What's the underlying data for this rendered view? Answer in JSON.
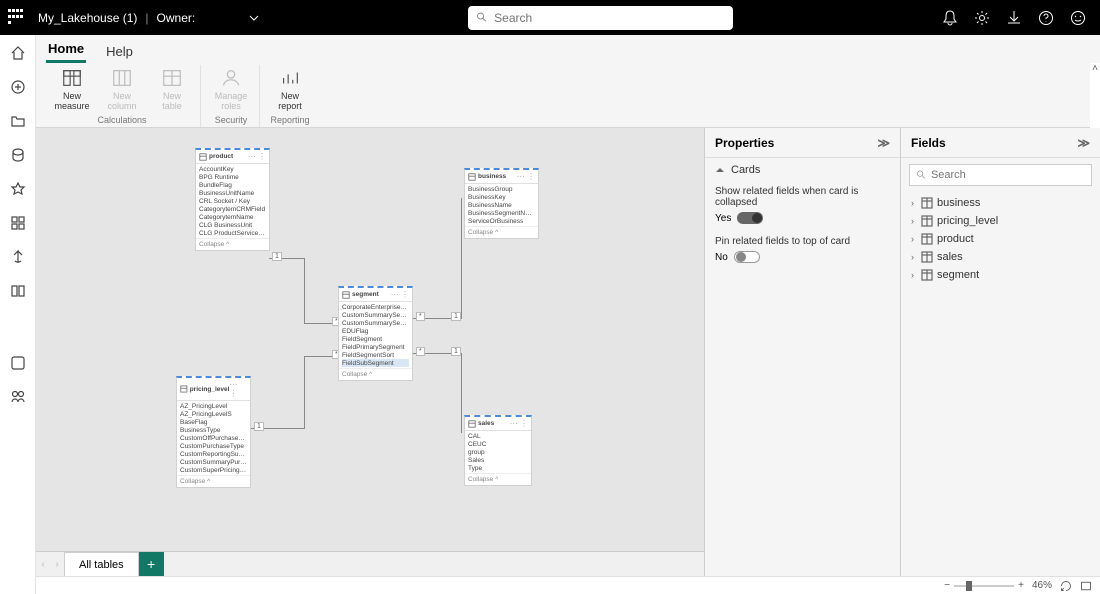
{
  "topbar": {
    "title": "My_Lakehouse (1)",
    "owner_label": "Owner:",
    "search_placeholder": "Search"
  },
  "ribbon": {
    "tabs": [
      "Home",
      "Help"
    ],
    "active_tab": 0,
    "groups": [
      {
        "label": "Calculations",
        "buttons": [
          {
            "l1": "New",
            "l2": "measure",
            "enabled": true
          },
          {
            "l1": "New",
            "l2": "column",
            "enabled": false
          },
          {
            "l1": "New",
            "l2": "table",
            "enabled": false
          }
        ]
      },
      {
        "label": "Security",
        "buttons": [
          {
            "l1": "Manage",
            "l2": "roles",
            "enabled": false
          }
        ]
      },
      {
        "label": "Reporting",
        "buttons": [
          {
            "l1": "New",
            "l2": "report",
            "enabled": true
          }
        ]
      }
    ]
  },
  "tables": {
    "product": {
      "name": "product",
      "collapse": "Collapse ^",
      "fields": [
        "AccountKey",
        "BPG Runtime",
        "BundleFlag",
        "BusinessUnitName",
        "CRL Socket / Key",
        "CategorytemCRMField",
        "CategorytemName",
        "CLG BusinessUnit",
        "CLG ProductServiceBundleDevice"
      ]
    },
    "business": {
      "name": "business",
      "collapse": "Collapse ^",
      "fields": [
        "BusinessGroup",
        "BusinessKey",
        "BusinessName",
        "BusinessSegmentName",
        "ServiceOrBusiness"
      ]
    },
    "segment": {
      "name": "segment",
      "collapse": "Collapse ^",
      "fields": [
        "CorporateEnterpriseFlag",
        "CustomSummarySector",
        "CustomSummarySegment",
        "EDUFlag",
        "FieldSegment",
        "FieldPrimarySegment",
        "FieldSegmentSort",
        "FieldSubSegment"
      ]
    },
    "pricing_level": {
      "name": "pricing_level",
      "collapse": "Collapse ^",
      "fields": [
        "AZ_PricingLevel",
        "AZ_PricingLevelS",
        "BaseFlag",
        "BusinessType",
        "CustomOffPurchaseType",
        "CustomPurchaseType",
        "CustomReportingSummaryPurcha",
        "CustomSummaryPurchaseType",
        "CustomSuperPricingLevel"
      ]
    },
    "sales": {
      "name": "sales",
      "collapse": "Collapse ^",
      "fields": [
        "CAL",
        "CEUC",
        "group",
        "Sales",
        "Type"
      ]
    }
  },
  "bottom": {
    "tab": "All tables"
  },
  "properties": {
    "title": "Properties",
    "section": "Cards",
    "opt1_label": "Show related fields when card is collapsed",
    "opt1_state": "Yes",
    "opt2_label": "Pin related fields to top of card",
    "opt2_state": "No"
  },
  "fields": {
    "title": "Fields",
    "search_placeholder": "Search",
    "list": [
      "business",
      "pricing_level",
      "product",
      "sales",
      "segment"
    ]
  },
  "status": {
    "zoom": "46%"
  }
}
